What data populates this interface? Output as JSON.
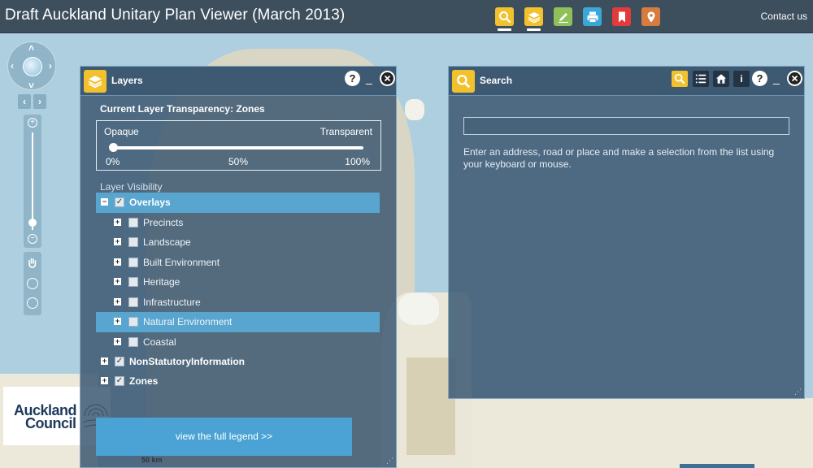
{
  "header": {
    "title": "Draft Auckland Unitary Plan Viewer (March 2013)",
    "contact_label": "Contact us",
    "tools": [
      {
        "icon": "magnifier-icon",
        "color": "#f2c12e",
        "active": true
      },
      {
        "icon": "layers-icon",
        "color": "#f2c12e",
        "active": true
      },
      {
        "icon": "pencil-icon",
        "color": "#8fc05a",
        "active": false
      },
      {
        "icon": "printer-icon",
        "color": "#3aa7d9",
        "active": false
      },
      {
        "icon": "bookmark-icon",
        "color": "#e23b3b",
        "active": false
      },
      {
        "icon": "location-pin-icon",
        "color": "#d77b3f",
        "active": false
      }
    ]
  },
  "map": {
    "scale_label": "50 km",
    "logo": {
      "line1": "Auckland",
      "line2": "Council"
    }
  },
  "layers_panel": {
    "title": "Layers",
    "icon_color": "#f2c12e",
    "transparency_title": "Current Layer Transparency: Zones",
    "opaque_label": "Opaque",
    "transparent_label": "Transparent",
    "transparency_value": 0,
    "ticks": {
      "min": "0%",
      "mid": "50%",
      "max": "100%"
    },
    "visibility_title": "Layer Visibility",
    "tree": {
      "overlays": {
        "label": "Overlays",
        "checked": true,
        "expanded": true
      },
      "children": [
        {
          "label": "Precincts",
          "checked": false
        },
        {
          "label": "Landscape",
          "checked": false
        },
        {
          "label": "Built Environment",
          "checked": false
        },
        {
          "label": "Heritage",
          "checked": false
        },
        {
          "label": "Infrastructure",
          "checked": false
        },
        {
          "label": "Natural Environment",
          "checked": false,
          "highlighted": true
        },
        {
          "label": "Coastal",
          "checked": false
        }
      ],
      "nonstatutory": {
        "label": "NonStatutoryInformation",
        "checked": true
      },
      "zones": {
        "label": "Zones",
        "checked": true
      }
    },
    "legend_button": "view the full legend >>"
  },
  "search_panel": {
    "title": "Search",
    "icon_color": "#f2c12e",
    "input_value": "",
    "help_text": "Enter an address, road or place and make a selection from the list using your keyboard or mouse.",
    "info_label": "i",
    "help_label": "?"
  }
}
